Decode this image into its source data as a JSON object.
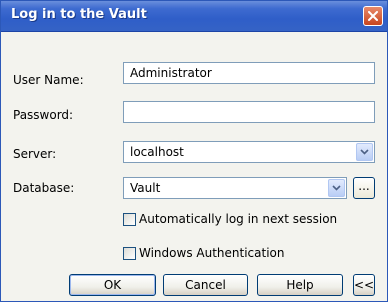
{
  "window": {
    "title": "Log in to the Vault"
  },
  "form": {
    "user_name": {
      "label": "User Name:",
      "value": "Administrator"
    },
    "password": {
      "label": "Password:",
      "value": ""
    },
    "server": {
      "label": "Server:",
      "value": "localhost"
    },
    "database": {
      "label": "Database:",
      "value": "Vault",
      "browse_label": "..."
    }
  },
  "options": {
    "auto_login": {
      "label": "Automatically log in next session",
      "checked": false
    },
    "windows_auth": {
      "label": "Windows Authentication",
      "checked": false
    }
  },
  "buttons": {
    "ok": "OK",
    "cancel": "Cancel",
    "help": "Help",
    "collapse": "<<"
  },
  "colors": {
    "titlebar": "#2f5ec8",
    "close_button": "#c8451f",
    "field_border": "#7f9db9"
  },
  "icons": {
    "close": "close-icon",
    "dropdown": "chevron-down-icon"
  }
}
